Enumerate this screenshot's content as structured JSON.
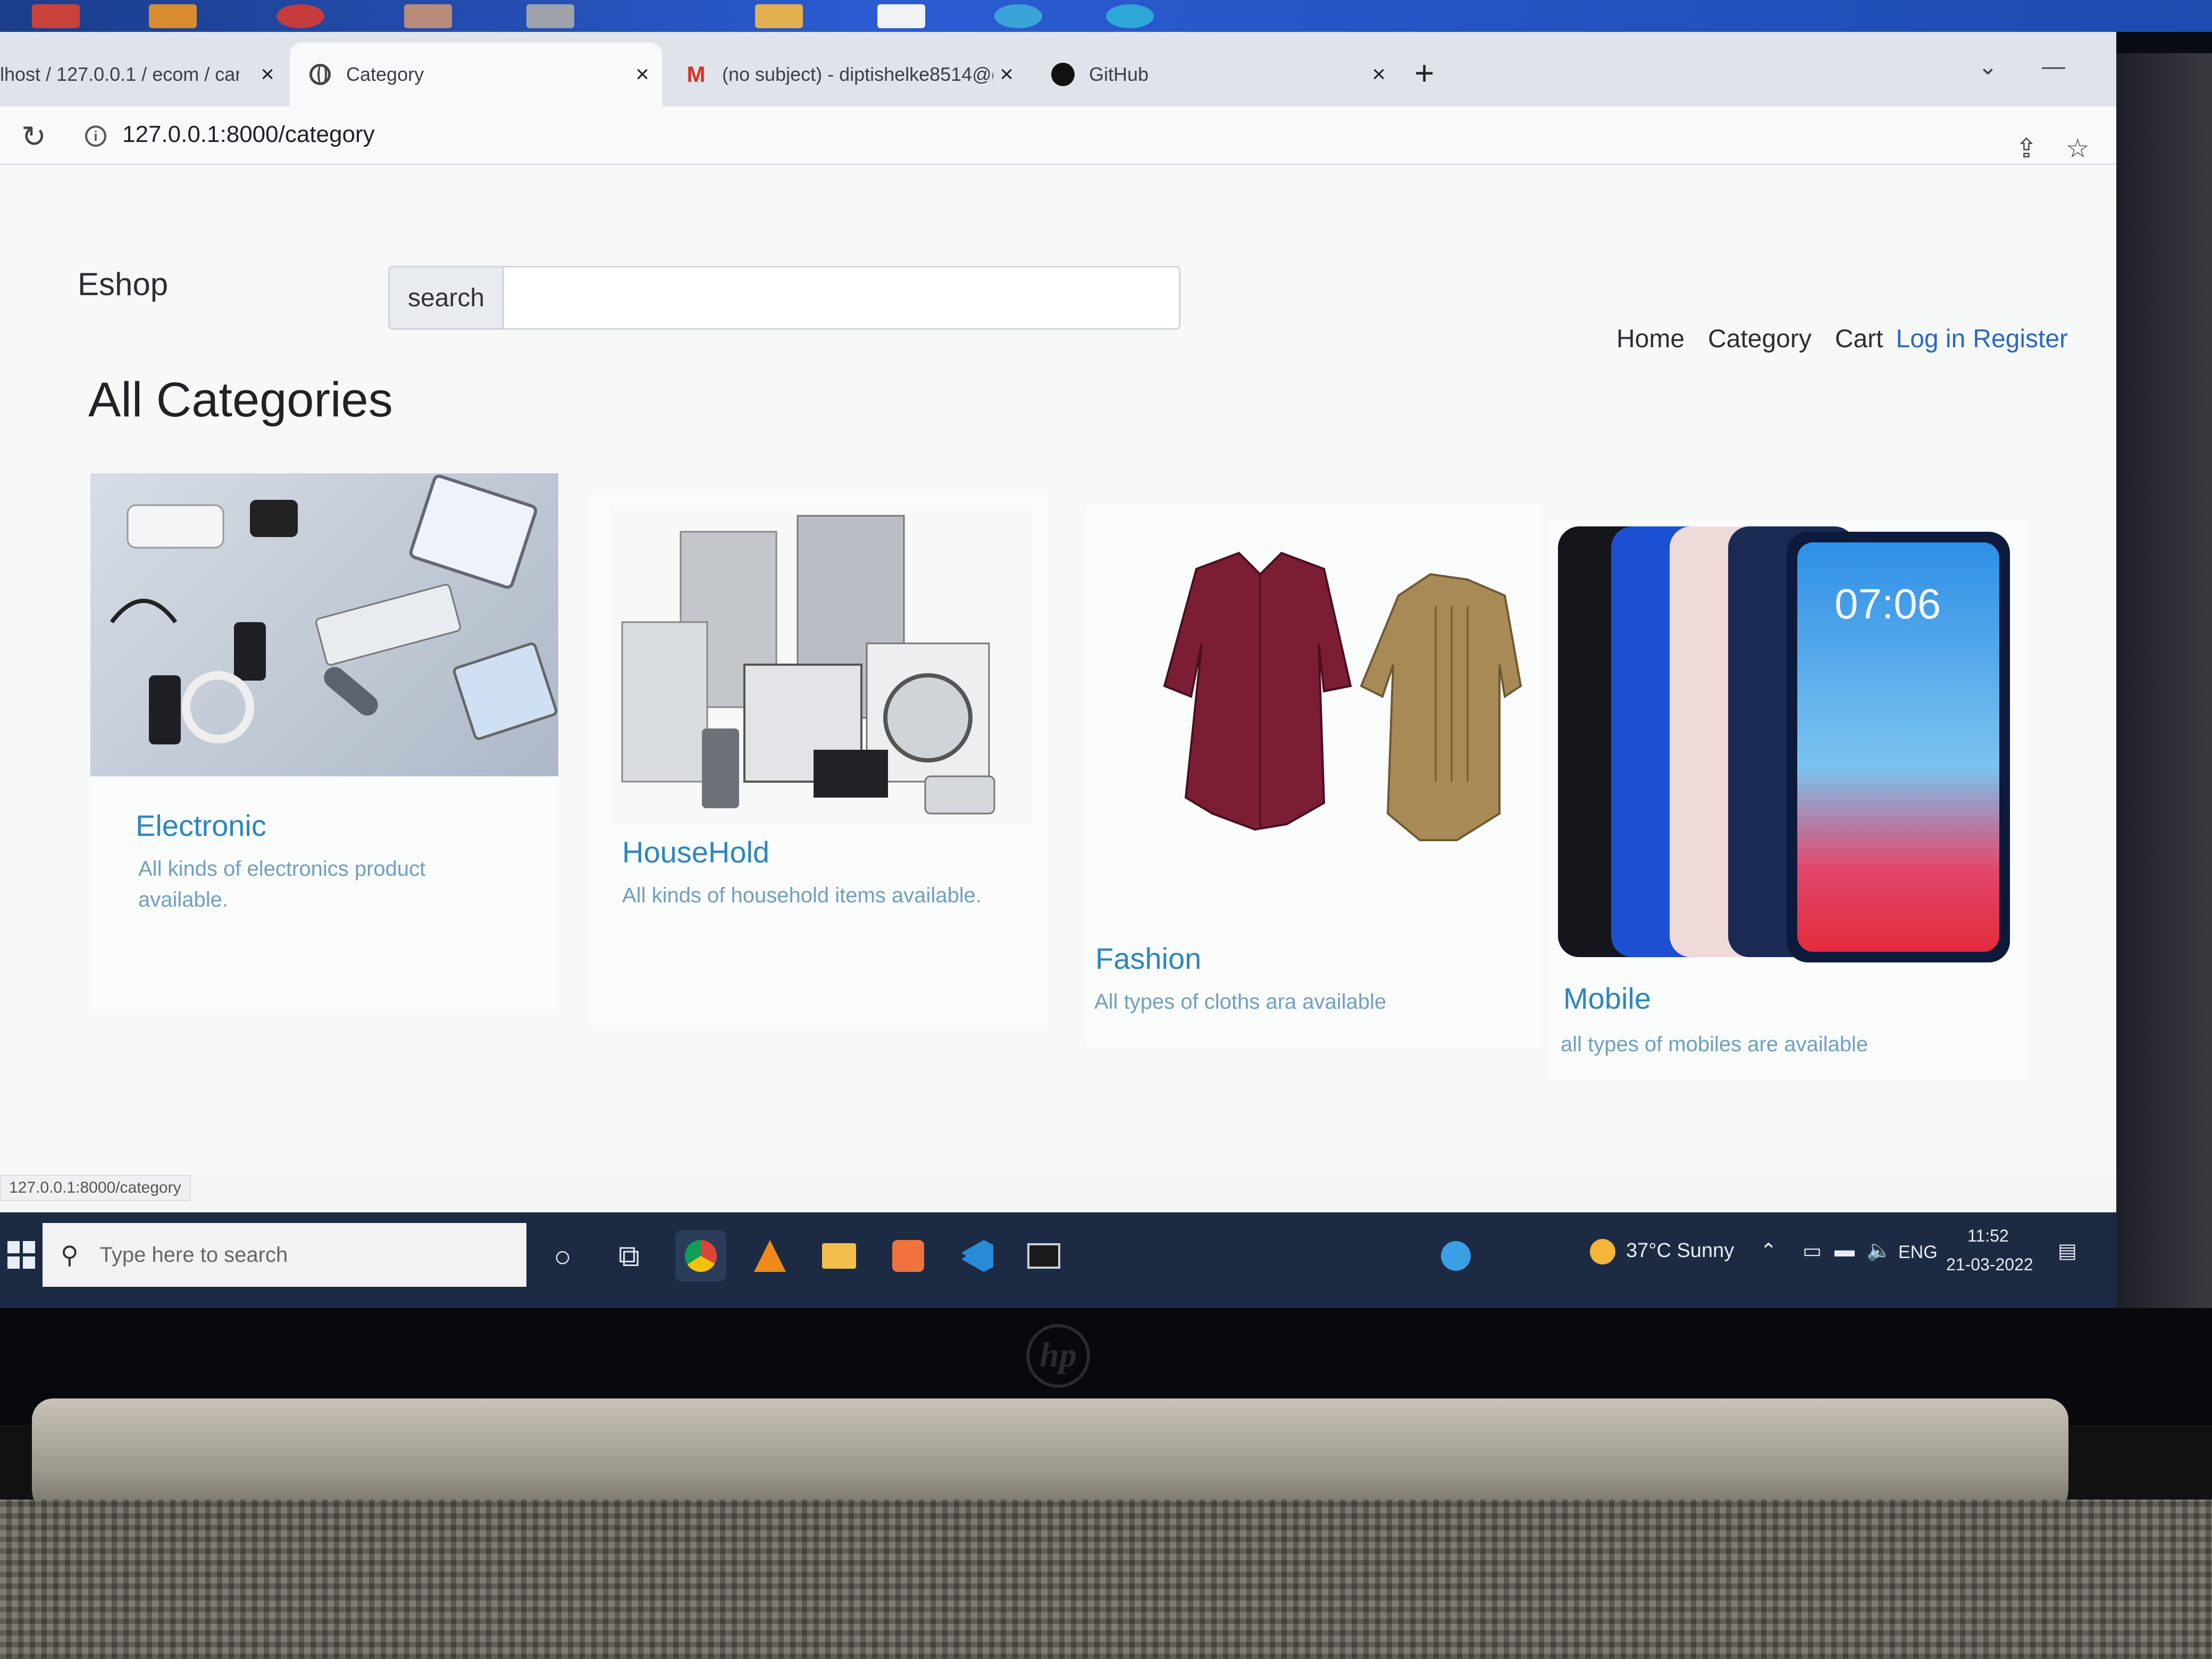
{
  "browser": {
    "tabs": [
      {
        "label": "lhost / 127.0.0.1 / ecom / car",
        "close": "×"
      },
      {
        "label": "Category",
        "close": "×",
        "active": true
      },
      {
        "label": "(no subject) - diptishelke8514@g",
        "close": "×"
      },
      {
        "label": "GitHub",
        "close": "×"
      }
    ],
    "new_tab": "+",
    "url": "127.0.0.1:8000/category",
    "status_url": "127.0.0.1:8000/category"
  },
  "site": {
    "brand": "Eshop",
    "search_label": "search",
    "search_value": "",
    "nav": {
      "home": "Home",
      "category": "Category",
      "cart": "Cart",
      "login": "Log in",
      "register": "Register"
    },
    "heading": "All Categories",
    "categories": [
      {
        "title": "Electronic",
        "desc": "All kinds of electronics product available."
      },
      {
        "title": "HouseHold",
        "desc": "All kinds of household items available."
      },
      {
        "title": "Fashion",
        "desc": "All types of cloths ara available"
      },
      {
        "title": "Mobile",
        "desc": "all types of mobiles are available",
        "phone_time": "07:06"
      }
    ]
  },
  "taskbar": {
    "search_placeholder": "Type here to search",
    "weather": "37°C  Sunny",
    "language": "ENG",
    "time": "11:52",
    "date": "21-03-2022"
  },
  "colors": {
    "accent_link": "#2c86bf",
    "auth_link": "#2a66c9",
    "taskbar": "#1c2b43"
  }
}
